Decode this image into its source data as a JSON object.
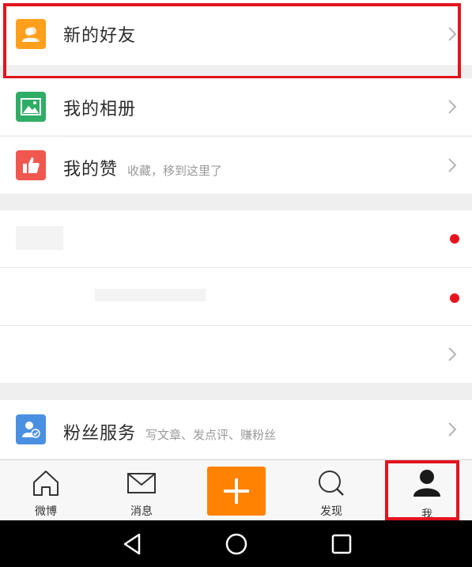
{
  "menu": {
    "new_friends": {
      "label": "新的好友",
      "icon": "friends-icon",
      "color": "#ff9f1c"
    },
    "album": {
      "label": "我的相册",
      "icon": "picture-icon",
      "color": "#2fad66"
    },
    "likes": {
      "label": "我的赞",
      "subtitle": "收藏，移到这里了",
      "icon": "thumbs-up-icon",
      "color": "#f0574e"
    },
    "fans": {
      "label": "粉丝服务",
      "subtitle": "写文章、发点评、赚粉丝",
      "icon": "fans-service-icon",
      "color": "#4a90e2"
    }
  },
  "tabs": {
    "home": "微博",
    "messages": "消息",
    "discover": "发现",
    "me": "我"
  },
  "colors": {
    "accent": "#ff8200",
    "highlight_box": "#e2141d",
    "badge": "#e8131e"
  }
}
